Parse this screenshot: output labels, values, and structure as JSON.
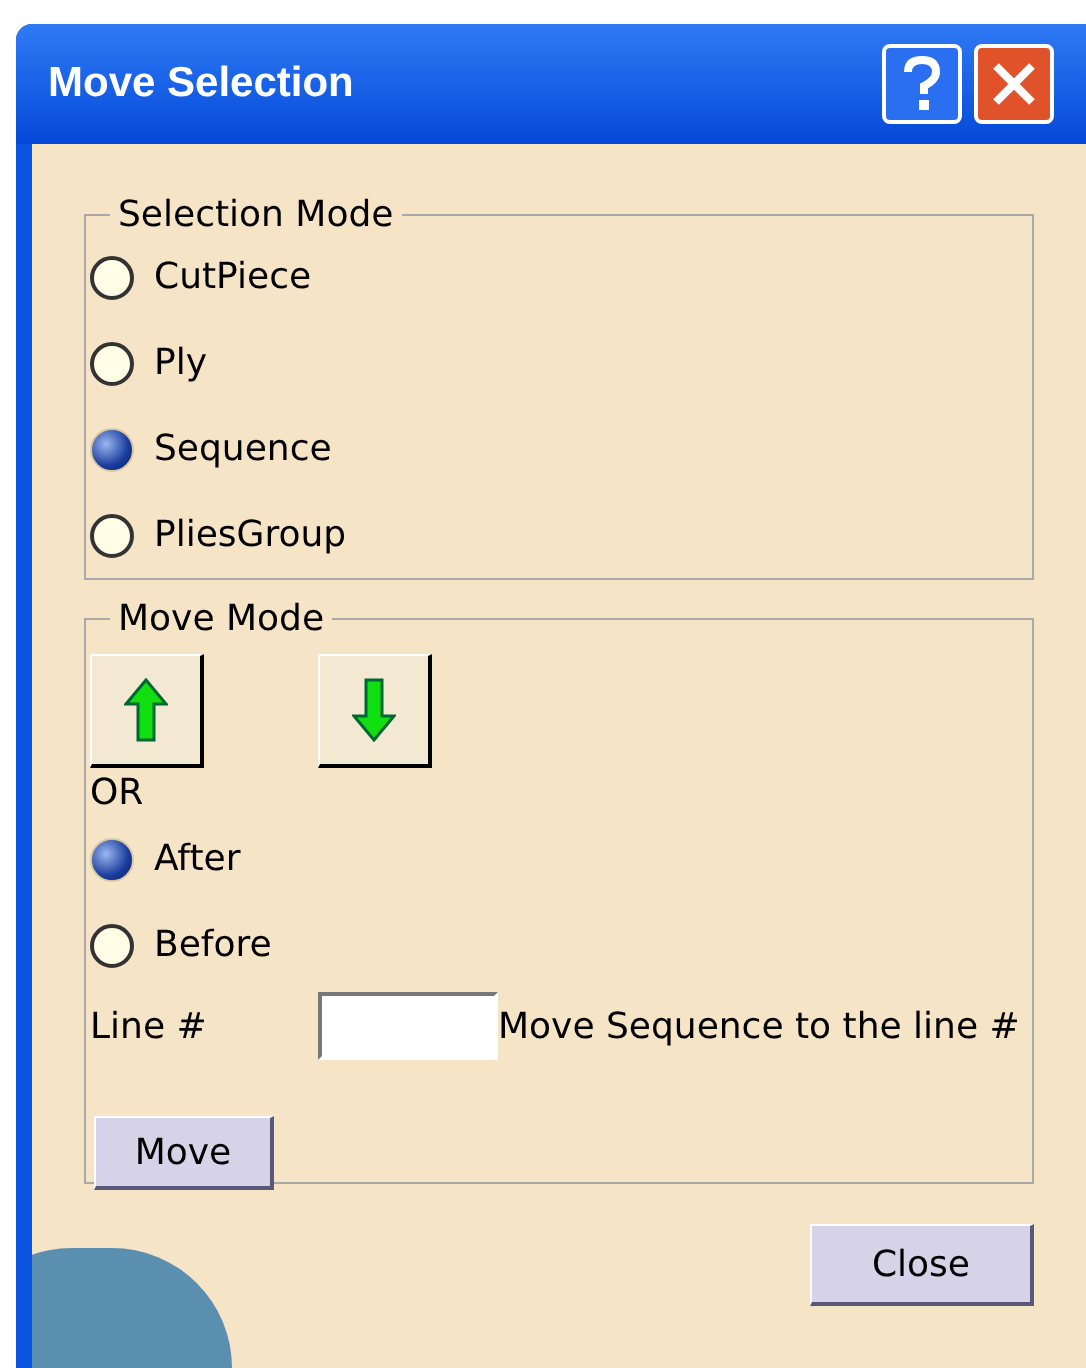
{
  "window": {
    "title": "Move Selection"
  },
  "selection_mode": {
    "title": "Selection Mode",
    "options": [
      {
        "label": "CutPiece",
        "selected": false
      },
      {
        "label": "Ply",
        "selected": false
      },
      {
        "label": "Sequence",
        "selected": true
      },
      {
        "label": "PliesGroup",
        "selected": false
      }
    ]
  },
  "move_mode": {
    "title": "Move Mode",
    "or_label": "OR",
    "options": [
      {
        "label": "After",
        "selected": true
      },
      {
        "label": "Before",
        "selected": false
      }
    ],
    "line_label": "Line #",
    "line_hint": "Move Sequence to the line #",
    "move_button": "Move"
  },
  "close_button": "Close"
}
